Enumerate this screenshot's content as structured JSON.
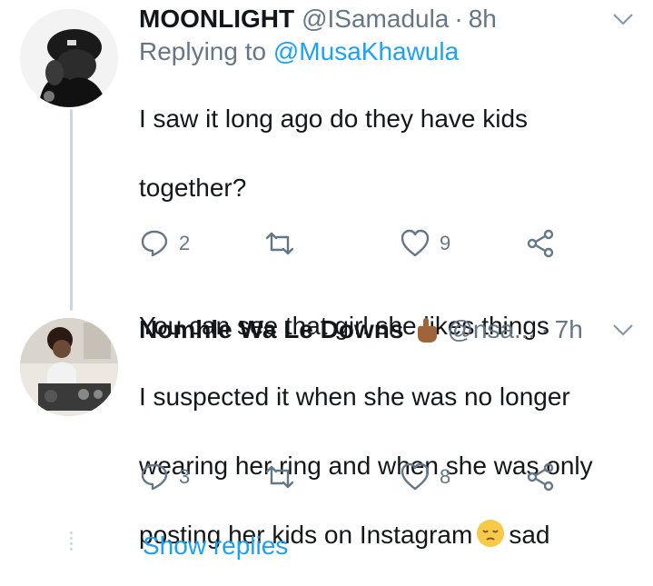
{
  "tweets": [
    {
      "name": "MOONLIGHT",
      "handle": "@ISamadula",
      "time": "8h",
      "replying_prefix": "Replying to",
      "replying_to": "@MusaKhawula",
      "text_line1": "I saw it long ago do they have kids",
      "text_line2": "together?",
      "text_line3": "You can see that girl she likes things",
      "replies": "2",
      "likes": "9"
    },
    {
      "name": "Nomhle Wa Le Downs",
      "handle": "@nsa...",
      "time": "7h",
      "text_line1": "I suspected it when she was no longer",
      "text_line2": "wearing her ring and when she was only",
      "text_line3_before": "posting her kids on Instagram",
      "text_line3_after": "sad",
      "replies": "3",
      "likes": "8"
    }
  ],
  "show_replies": "Show replies",
  "colors": {
    "text": "#14171a",
    "muted": "#657786",
    "link": "#1da1f2",
    "thread": "#ccd6dd"
  }
}
